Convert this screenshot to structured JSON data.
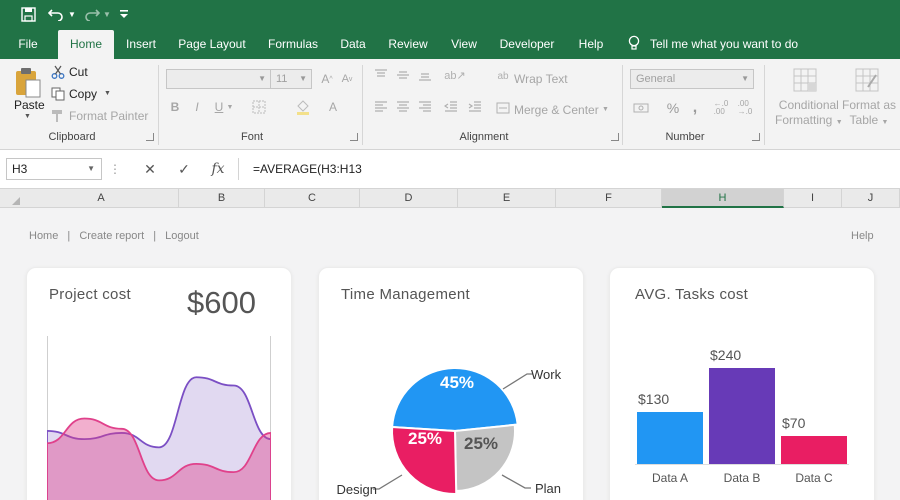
{
  "window": {
    "quick_access": [
      "save-icon",
      "undo-icon",
      "redo-icon",
      "customize-icon"
    ]
  },
  "ribbon_tabs": [
    {
      "label": "File",
      "active": false
    },
    {
      "label": "Home",
      "active": true
    },
    {
      "label": "Insert",
      "active": false
    },
    {
      "label": "Page Layout",
      "active": false
    },
    {
      "label": "Formulas",
      "active": false
    },
    {
      "label": "Data",
      "active": false
    },
    {
      "label": "Review",
      "active": false
    },
    {
      "label": "View",
      "active": false
    },
    {
      "label": "Developer",
      "active": false
    },
    {
      "label": "Help",
      "active": false
    }
  ],
  "tell_me": "Tell me what you want to do",
  "clipboard": {
    "paste": "Paste",
    "cut": "Cut",
    "copy": "Copy",
    "format_painter": "Format Painter",
    "label": "Clipboard"
  },
  "font": {
    "font_name": "",
    "font_size": "11",
    "label": "Font"
  },
  "alignment": {
    "wrap_text": "Wrap Text",
    "merge_center": "Merge & Center",
    "label": "Alignment"
  },
  "number": {
    "format": "General",
    "label": "Number"
  },
  "styles": {
    "conditional_formatting": [
      "Conditional",
      "Formatting"
    ],
    "format_as_table": [
      "Format as",
      "Table"
    ]
  },
  "formula_bar": {
    "name_box": "H3",
    "formula": "=AVERAGE(H3:H13"
  },
  "columns": [
    "A",
    "B",
    "C",
    "D",
    "E",
    "F",
    "H",
    "I",
    "J"
  ],
  "selected_column": "H",
  "dashboard": {
    "nav": [
      "Home",
      "Create report",
      "Logout"
    ],
    "help": "Help",
    "project_cost": {
      "title": "Project cost",
      "value": "$600"
    },
    "time_management": {
      "title": "Time Management"
    },
    "tasks_cost": {
      "title": "AVG. Tasks cost"
    }
  },
  "colors": {
    "excel_green": "#217346",
    "purple_area": "#7b4fc4",
    "pink_area": "#e0418b",
    "pie_blue": "#2196f3",
    "pie_pink": "#e91e63",
    "pie_gray": "#c4c4c4",
    "bar_blue": "#2196f3",
    "bar_purple": "#673ab7",
    "bar_pink": "#e91e63"
  },
  "chart_data": [
    {
      "type": "area",
      "title": "",
      "x": [
        0,
        1,
        2,
        3,
        4,
        5,
        6
      ],
      "series": [
        {
          "values": [
            3.4,
            3.0,
            3.3,
            2.6,
            6.0,
            5.6,
            3.0
          ]
        },
        {
          "values": [
            2.8,
            4.0,
            3.5,
            1.0,
            1.8,
            1.4,
            3.3
          ]
        }
      ],
      "ylim": [
        0,
        8
      ],
      "grid": false
    },
    {
      "type": "pie",
      "categories": [
        "Work",
        "Design",
        "Plan"
      ],
      "values": [
        45,
        25,
        25
      ],
      "labels": [
        "45%",
        "25%",
        "25%"
      ]
    },
    {
      "type": "bar",
      "categories": [
        "Data A",
        "Data B",
        "Data C"
      ],
      "values": [
        130,
        240,
        70
      ],
      "labels": [
        "$130",
        "$240",
        "$70"
      ],
      "ylim": [
        0,
        240
      ]
    }
  ]
}
